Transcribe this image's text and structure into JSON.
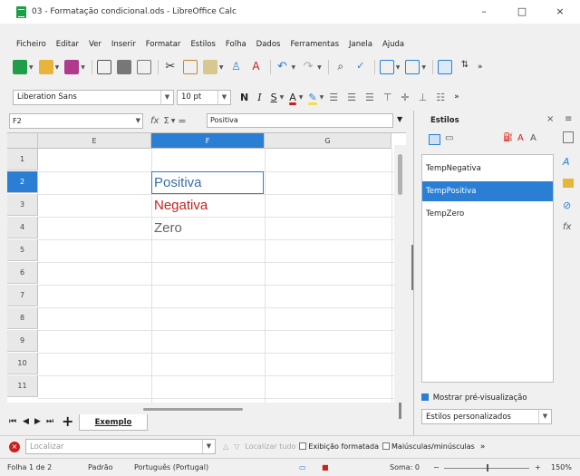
{
  "window": {
    "title": "03 - Formatação condicional.ods - LibreOffice Calc",
    "min": "–",
    "max": "□",
    "close": "×"
  },
  "menu": [
    "Ficheiro",
    "Editar",
    "Ver",
    "Inserir",
    "Formatar",
    "Estilos",
    "Folha",
    "Dados",
    "Ferramentas",
    "Janela",
    "Ajuda"
  ],
  "font": {
    "name": "Liberation Sans",
    "size": "10 pt"
  },
  "format_buttons": {
    "bold": "N",
    "italic": "I",
    "underline": "S"
  },
  "formula_bar": {
    "name_box": "F2",
    "fx": "fx",
    "sum": "Σ",
    "equals": "=",
    "content": "Positiva"
  },
  "grid": {
    "columns": [
      "E",
      "F",
      "G"
    ],
    "selected_column": "F",
    "rows": [
      "1",
      "2",
      "3",
      "4",
      "5",
      "6",
      "7",
      "8",
      "9",
      "10",
      "11"
    ],
    "selected_row": "2",
    "cells": [
      {
        "ref": "F2",
        "value": "Positiva",
        "color": "#3a6ea5"
      },
      {
        "ref": "F3",
        "value": "Negativa",
        "color": "#c9211e"
      },
      {
        "ref": "F4",
        "value": "Zero",
        "color": "#666666"
      }
    ]
  },
  "sheet_tabs": {
    "active": "Exemplo",
    "add": "+"
  },
  "sidebar": {
    "title": "Estilos",
    "styles": [
      {
        "name": "TempNegativa",
        "selected": false
      },
      {
        "name": "TempPositiva",
        "selected": true
      },
      {
        "name": "TempZero",
        "selected": false
      }
    ],
    "preview_label": "Mostrar pré-visualização",
    "preview_checked": true,
    "filter_value": "Estilos personalizados"
  },
  "findbar": {
    "placeholder": "Localizar",
    "find_all": "Localizar tudo",
    "formatted_display": "Exibição formatada",
    "match_case": "Maiúsculas/minúsculas"
  },
  "statusbar": {
    "sheet": "Folha 1 de 2",
    "page_style": "Padrão",
    "language": "Português (Portugal)",
    "sum": "Soma: 0",
    "zoom": "150%"
  }
}
